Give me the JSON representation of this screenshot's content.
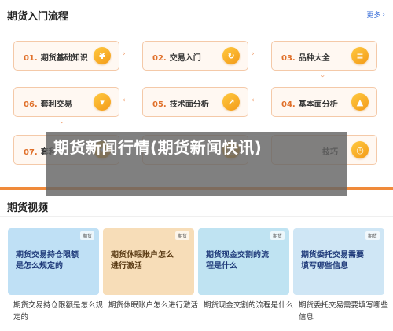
{
  "intro": {
    "title": "期货入门流程",
    "more": "更多"
  },
  "steps": [
    {
      "num": "01.",
      "label": "期货基础知识",
      "icon": "coin-icon"
    },
    {
      "num": "02.",
      "label": "交易入门",
      "icon": "refresh-icon"
    },
    {
      "num": "03.",
      "label": "品种大全",
      "icon": "document-icon"
    },
    {
      "num": "06.",
      "label": "套利交易",
      "icon": "download-icon"
    },
    {
      "num": "05.",
      "label": "技术面分析",
      "icon": "chart-icon"
    },
    {
      "num": "04.",
      "label": "基本面分析",
      "icon": "bar-chart-icon"
    },
    {
      "num": "07.",
      "label": "套利",
      "icon": "star-icon"
    },
    {
      "num": "",
      "label": "",
      "icon": "book-icon"
    },
    {
      "num": "",
      "label": "技巧",
      "icon": "clock-icon"
    }
  ],
  "overlay": {
    "text": "期货新闻行情(期货新闻快讯)"
  },
  "videos": {
    "title": "期货视频",
    "items": [
      {
        "thumb_title": "期货交易持仓限额是怎么规定的",
        "logo": "期货",
        "caption": "期货交易持仓限额是怎么规定的",
        "color": "#bfe0f5"
      },
      {
        "thumb_title": "期货休眠账户怎么进行激活",
        "logo": "期货",
        "caption": "期货休眠账户怎么进行激活",
        "color": "#f7ddb8"
      },
      {
        "thumb_title": "期货现金交割的流程是什么",
        "logo": "期货",
        "caption": "期货现金交割的流程是什么",
        "color": "#bfe3f2"
      },
      {
        "thumb_title": "期货委托交易需要填写哪些信息",
        "logo": "期货",
        "caption": "期货委托交易需要填写哪些信息",
        "color": "#cfe6f5"
      }
    ]
  }
}
